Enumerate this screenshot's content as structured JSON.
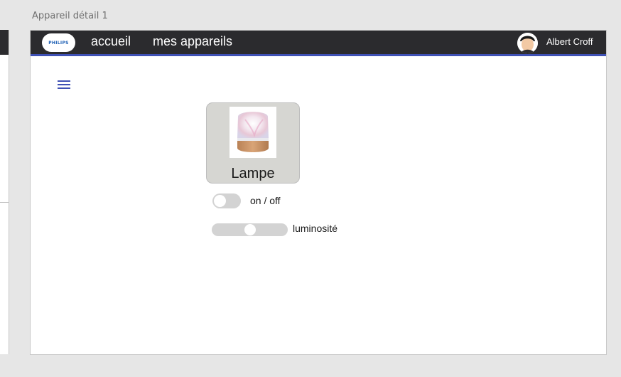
{
  "artboard": {
    "title": "Appareil détail 1"
  },
  "header": {
    "logo_text": "PHILIPS",
    "nav": [
      "accueil",
      "mes appareils"
    ],
    "user_name": "Albert Croff",
    "avatar_icon": "user-avatar-icon"
  },
  "colors": {
    "header_bg": "#2b2b2e",
    "accent": "#3f51b5",
    "card_bg": "#d6d6d2",
    "control_track": "#d3d3d3"
  },
  "menu": {
    "icon": "hamburger-menu-icon"
  },
  "device": {
    "name": "Lampe",
    "image_icon": "lamp-icon",
    "power": {
      "label": "on / off",
      "state": false
    },
    "brightness": {
      "label": "luminosité",
      "value": 0.5
    }
  }
}
